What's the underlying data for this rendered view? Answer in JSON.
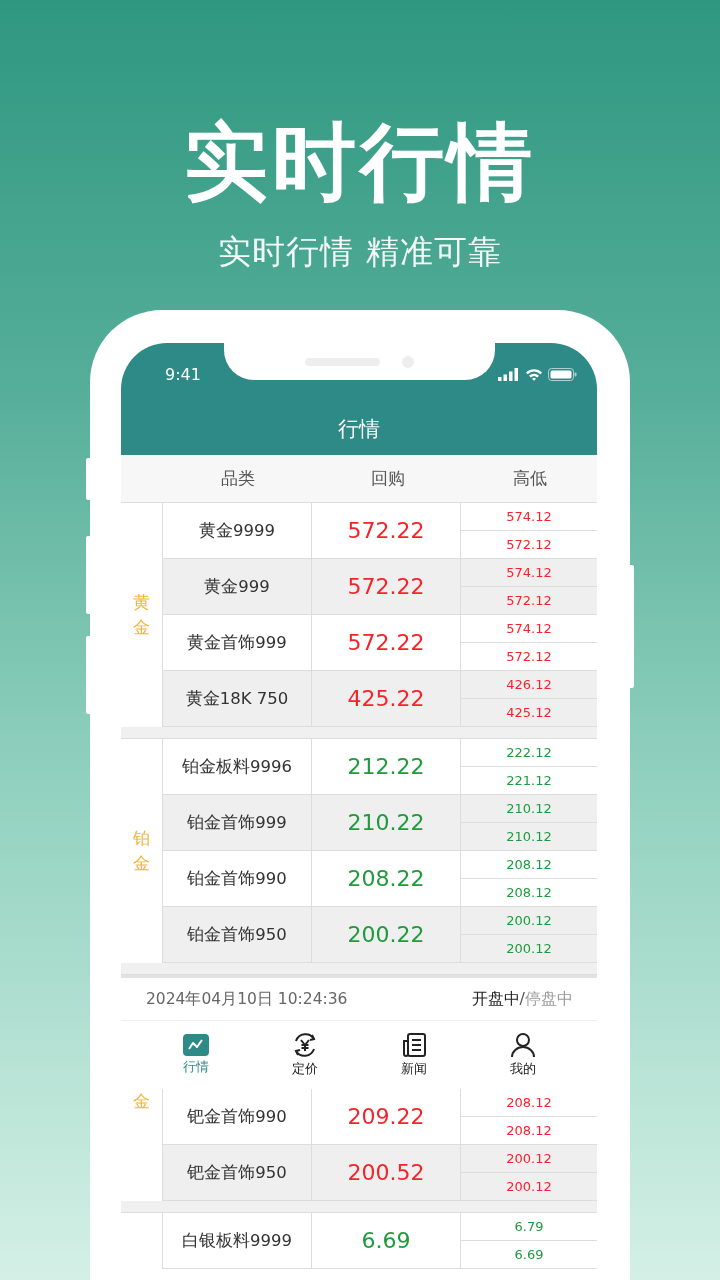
{
  "headline": "实时行情",
  "subtitle": "实时行情 精准可靠",
  "status_bar": {
    "time": "9:41"
  },
  "nav": {
    "title": "行情"
  },
  "table": {
    "columns": [
      "品类",
      "回购",
      "高低"
    ],
    "groups_top": [
      {
        "label": "黄金",
        "kind": "full",
        "rows": [
          {
            "name": "黄金9999",
            "price": "572.22",
            "high": "574.12",
            "low": "572.12",
            "kind": "up"
          },
          {
            "name": "黄金999",
            "price": "572.22",
            "high": "574.12",
            "low": "572.12",
            "kind": "up"
          },
          {
            "name": "黄金首饰999",
            "price": "572.22",
            "high": "574.12",
            "low": "572.12",
            "kind": "up"
          },
          {
            "name": "黄金18K 750",
            "price": "425.22",
            "high": "426.12",
            "low": "425.12",
            "kind": "up"
          }
        ]
      },
      {
        "label": "铂金",
        "kind": "full",
        "rows": [
          {
            "name": "铂金板料9996",
            "price": "212.22",
            "high": "222.12",
            "low": "221.12",
            "kind": "down"
          },
          {
            "name": "铂金首饰999",
            "price": "210.22",
            "high": "210.12",
            "low": "210.12",
            "kind": "down"
          },
          {
            "name": "铂金首饰990",
            "price": "208.22",
            "high": "208.12",
            "low": "208.12",
            "kind": "down"
          },
          {
            "name": "铂金首饰950",
            "price": "200.22",
            "high": "200.12",
            "low": "200.12",
            "kind": "down"
          }
        ]
      }
    ]
  },
  "info_bar": {
    "datetime": "2024年04月10日 10:24:36",
    "separator": "/",
    "states": [
      {
        "label": "开盘中",
        "selected": true
      },
      {
        "label": "停盘中",
        "selected": false
      }
    ]
  },
  "tabs": [
    {
      "label": "行情",
      "kind": "chart",
      "selected": true
    },
    {
      "label": "定价",
      "kind": "yen",
      "selected": false
    },
    {
      "label": "新闻",
      "kind": "news",
      "selected": false
    },
    {
      "label": "我的",
      "kind": "person",
      "selected": false
    }
  ],
  "table_bottom": {
    "groups": [
      {
        "label": "金",
        "kind": "cut",
        "rows": [
          {
            "name": "钯金首饰990",
            "price": "209.22",
            "high": "208.12",
            "low": "208.12",
            "kind": "up"
          },
          {
            "name": "钯金首饰950",
            "price": "200.52",
            "high": "200.12",
            "low": "200.12",
            "kind": "up"
          }
        ]
      },
      {
        "kind": "cut",
        "rows": [
          {
            "name": "白银板料9999",
            "price": "6.69",
            "high": "6.79",
            "low": "6.69",
            "kind": "down"
          }
        ]
      }
    ]
  }
}
